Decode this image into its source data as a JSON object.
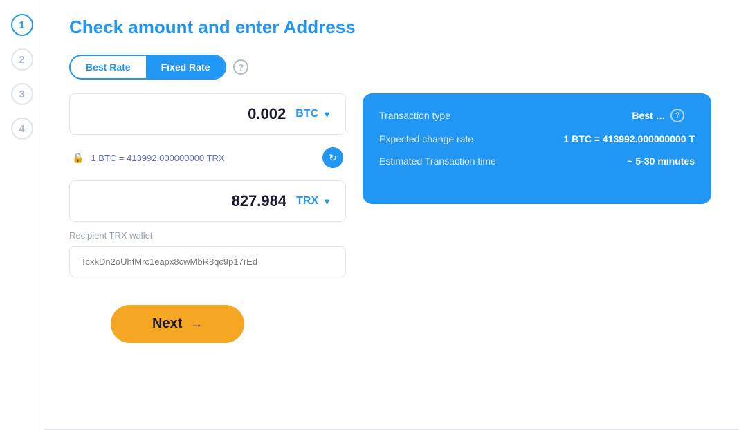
{
  "sidebar": {
    "steps": [
      {
        "number": "1",
        "state": "active"
      },
      {
        "number": "2",
        "state": "inactive"
      },
      {
        "number": "3",
        "state": "inactive"
      },
      {
        "number": "4",
        "state": "inactive"
      }
    ]
  },
  "header": {
    "title": "Check amount and enter Address"
  },
  "rate_toggle": {
    "best_rate_label": "Best Rate",
    "fixed_rate_label": "Fixed Rate",
    "help_symbol": "?",
    "active": "fixed"
  },
  "from_amount": {
    "value": "0.002",
    "currency": "BTC"
  },
  "rate_info": {
    "lock_symbol": "🔒",
    "text": "1 BTC = 413992.000000000 TRX"
  },
  "to_amount": {
    "value": "827.984",
    "currency": "TRX"
  },
  "recipient": {
    "label": "Recipient TRX wallet",
    "placeholder_text": "TcxkDn2oUhfMrc1eapx8cwMbR8qc9p17rEd"
  },
  "info_card": {
    "transaction_type_label": "Transaction type",
    "transaction_type_value": "Best Rate",
    "expected_change_rate_label": "Expected change rate",
    "expected_change_rate_value": "1 BTC = 413992.000000000 T",
    "estimated_time_label": "Estimated Transaction time",
    "estimated_time_value": "~ 5-30 minutes",
    "help_symbol": "?"
  },
  "next_button": {
    "label": "Next",
    "arrow": "→"
  }
}
